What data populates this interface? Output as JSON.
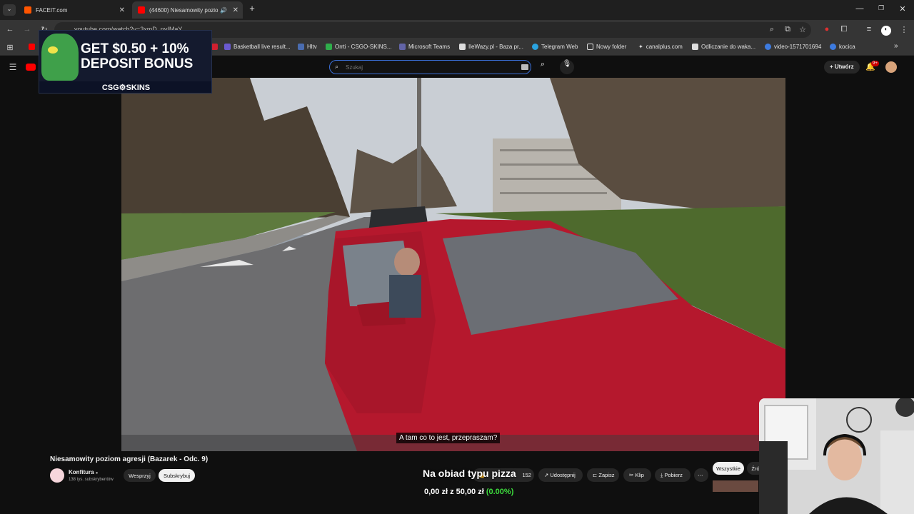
{
  "browser": {
    "tabs": [
      {
        "title": "FACEIT.com",
        "active": false
      },
      {
        "title": "(44600) Niesamowity pozio",
        "active": true
      }
    ],
    "url": "youtube.com/watch?v=3xmD_nyIMaY",
    "bookmarks": [
      "Basketball live result...",
      "Hltv",
      "Orrti - CSGO-SKINS...",
      "Microsoft Teams",
      "IleWazy.pl - Baza pr...",
      "Telegram Web",
      "Nowy folder",
      "canalplus.com",
      "Odliczanie do waka...",
      "video-1571701694",
      "kocica"
    ]
  },
  "ad": {
    "line1": "GET $0.50 + 10%",
    "line2": "DEPOSIT BONUS",
    "brand": "CSG⚙SKINS"
  },
  "youtube": {
    "search_placeholder": "Szukaj",
    "create_label": "Utwórz",
    "notification_count": "9+"
  },
  "video": {
    "subtitle": "A tam co to jest, przepraszam?",
    "title": "Niesamowity poziom agresji (Bazarek - Odc. 9)",
    "channel": "Konfitura",
    "subscribers": "138 tys. subskrybentów",
    "support_label": "Wesprzyj",
    "subscribe_label": "Subskrybuj",
    "likes": "152",
    "actions": [
      "Udostępnij",
      "Zapisz",
      "Klip",
      "Pobierz"
    ],
    "filter_all": "Wszystkie",
    "filter_more": "Źró"
  },
  "overlay": {
    "goal_text": "Na obiad typu pizza",
    "progress_text": "0,00 zł z 50,00 zł",
    "progress_percent": "(0.00%)"
  },
  "colors": {
    "accent_green": "#3ddc3d",
    "yt_red": "#ff0000",
    "search_border": "#3a6fd8"
  }
}
